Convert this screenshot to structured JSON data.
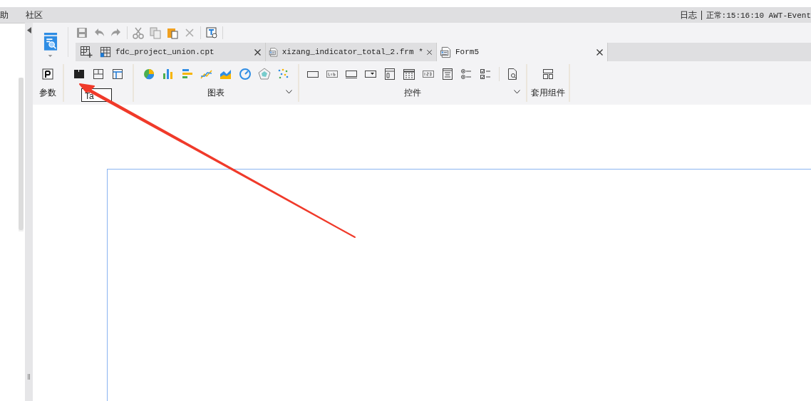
{
  "menu_bar": {
    "items": [
      "助",
      "社区"
    ],
    "log_label": "日志",
    "status": "正常:15:16:10 AWT-Event"
  },
  "tabs": [
    {
      "label": "fdc_project_union.cpt",
      "selected": false
    },
    {
      "label": "xizang_indicator_total_2.frm *",
      "selected": false
    },
    {
      "label": "Form5",
      "selected": true
    }
  ],
  "ribbon": {
    "groups": [
      {
        "label": "参数"
      },
      {
        "tooltip": "Ta"
      },
      {
        "label": "图表"
      },
      {
        "label": "控件"
      },
      {
        "label": "套用组件"
      }
    ]
  }
}
